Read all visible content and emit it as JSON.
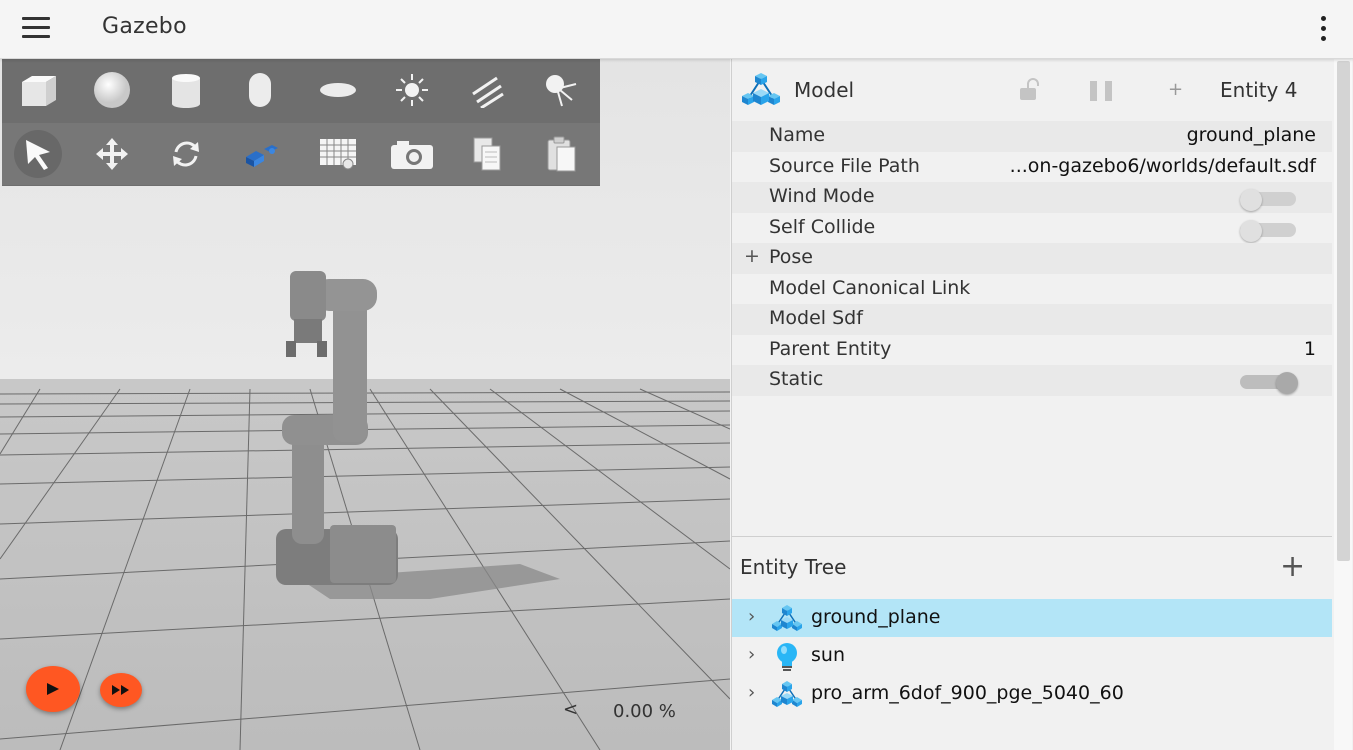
{
  "header": {
    "title": "Gazebo"
  },
  "toolbar": {
    "row1": [
      "box-icon",
      "sphere-icon",
      "cylinder-icon",
      "capsule-icon",
      "ellipsoid-icon",
      "sun-light-icon",
      "directional-light-icon",
      "spot-light-icon"
    ],
    "row2": [
      "select-arrow-icon",
      "translate-icon",
      "rotate-icon",
      "transform-control-icon",
      "grid-icon",
      "camera-icon",
      "copy-icon",
      "paste-icon"
    ]
  },
  "playback": {
    "play_icon": "play-icon",
    "step_icon": "fast-forward-icon",
    "rtf_chevron": "<",
    "rtf_value": "0.00 %"
  },
  "inspector": {
    "title": "Model",
    "entity_label": "Entity 4",
    "add_symbol": "+",
    "properties": [
      {
        "label": "Name",
        "value": "ground_plane"
      },
      {
        "label": "Source File Path",
        "value": "...on-gazebo6/worlds/default.sdf"
      },
      {
        "label": "Wind Mode",
        "toggle": false
      },
      {
        "label": "Self Collide",
        "toggle": false
      },
      {
        "label": "Pose",
        "expander": "+"
      },
      {
        "label": "Model Canonical Link",
        "value": ""
      },
      {
        "label": "Model Sdf",
        "value": ""
      },
      {
        "label": "Parent Entity",
        "value": "1"
      },
      {
        "label": "Static",
        "toggle": true
      }
    ]
  },
  "entity_tree": {
    "title": "Entity Tree",
    "add_symbol": "+",
    "items": [
      {
        "name": "ground_plane",
        "icon": "model-icon",
        "selected": true
      },
      {
        "name": "sun",
        "icon": "light-bulb-icon",
        "selected": false
      },
      {
        "name": "pro_arm_6dof_900_pge_5040_60",
        "icon": "model-icon",
        "selected": false
      }
    ]
  },
  "colors": {
    "accent": "#ff5722",
    "selection": "#b3e5f7",
    "toolbar": "#6e6e6e",
    "model_icon": "#1e9be0"
  }
}
